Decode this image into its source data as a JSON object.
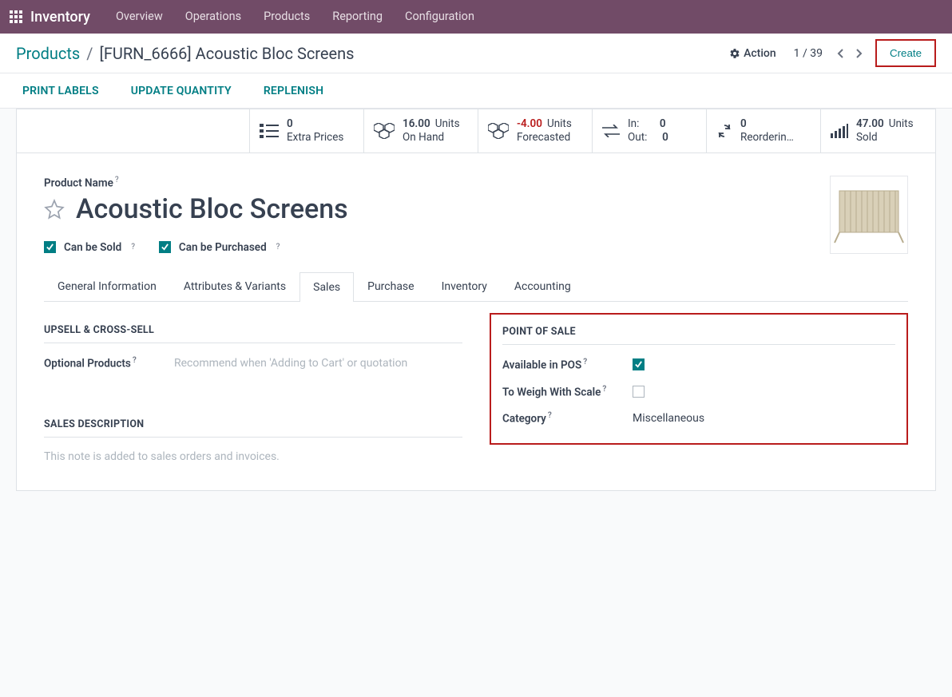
{
  "navbar": {
    "brand": "Inventory",
    "items": [
      "Overview",
      "Operations",
      "Products",
      "Reporting",
      "Configuration"
    ]
  },
  "breadcrumb": {
    "root": "Products",
    "current": "[FURN_6666] Acoustic Bloc Screens"
  },
  "toolbar": {
    "action": "Action",
    "pager": "1 / 39",
    "create": "Create"
  },
  "actionbar": {
    "print_labels": "PRINT LABELS",
    "update_qty": "UPDATE QUANTITY",
    "replenish": "REPLENISH"
  },
  "stats": {
    "extra_prices": {
      "value": "0",
      "label": "Extra Prices"
    },
    "on_hand": {
      "value": "16.00",
      "unit": "Units",
      "label": "On Hand"
    },
    "forecasted": {
      "value": "-4.00",
      "unit": "Units",
      "label": "Forecasted"
    },
    "inout": {
      "in_label": "In:",
      "in_value": "0",
      "out_label": "Out:",
      "out_value": "0"
    },
    "reordering": {
      "value": "0",
      "label": "Reorderin…"
    },
    "sold": {
      "value": "47.00",
      "unit": "Units",
      "label": "Sold"
    }
  },
  "form": {
    "product_name_label": "Product Name",
    "product_name": "Acoustic Bloc Screens",
    "can_be_sold": "Can be Sold",
    "can_be_purchased": "Can be Purchased"
  },
  "tabs": {
    "general": "General Information",
    "attributes": "Attributes & Variants",
    "sales": "Sales",
    "purchase": "Purchase",
    "inventory": "Inventory",
    "accounting": "Accounting"
  },
  "sales_tab": {
    "upsell_title": "UPSELL & CROSS-SELL",
    "optional_products": "Optional Products",
    "optional_placeholder": "Recommend when 'Adding to Cart' or quotation",
    "pos_title": "POINT OF SALE",
    "available_pos": "Available in POS",
    "to_weigh": "To Weigh With Scale",
    "category_label": "Category",
    "category_value": "Miscellaneous",
    "sales_desc_title": "SALES DESCRIPTION",
    "sales_desc_placeholder": "This note is added to sales orders and invoices."
  }
}
